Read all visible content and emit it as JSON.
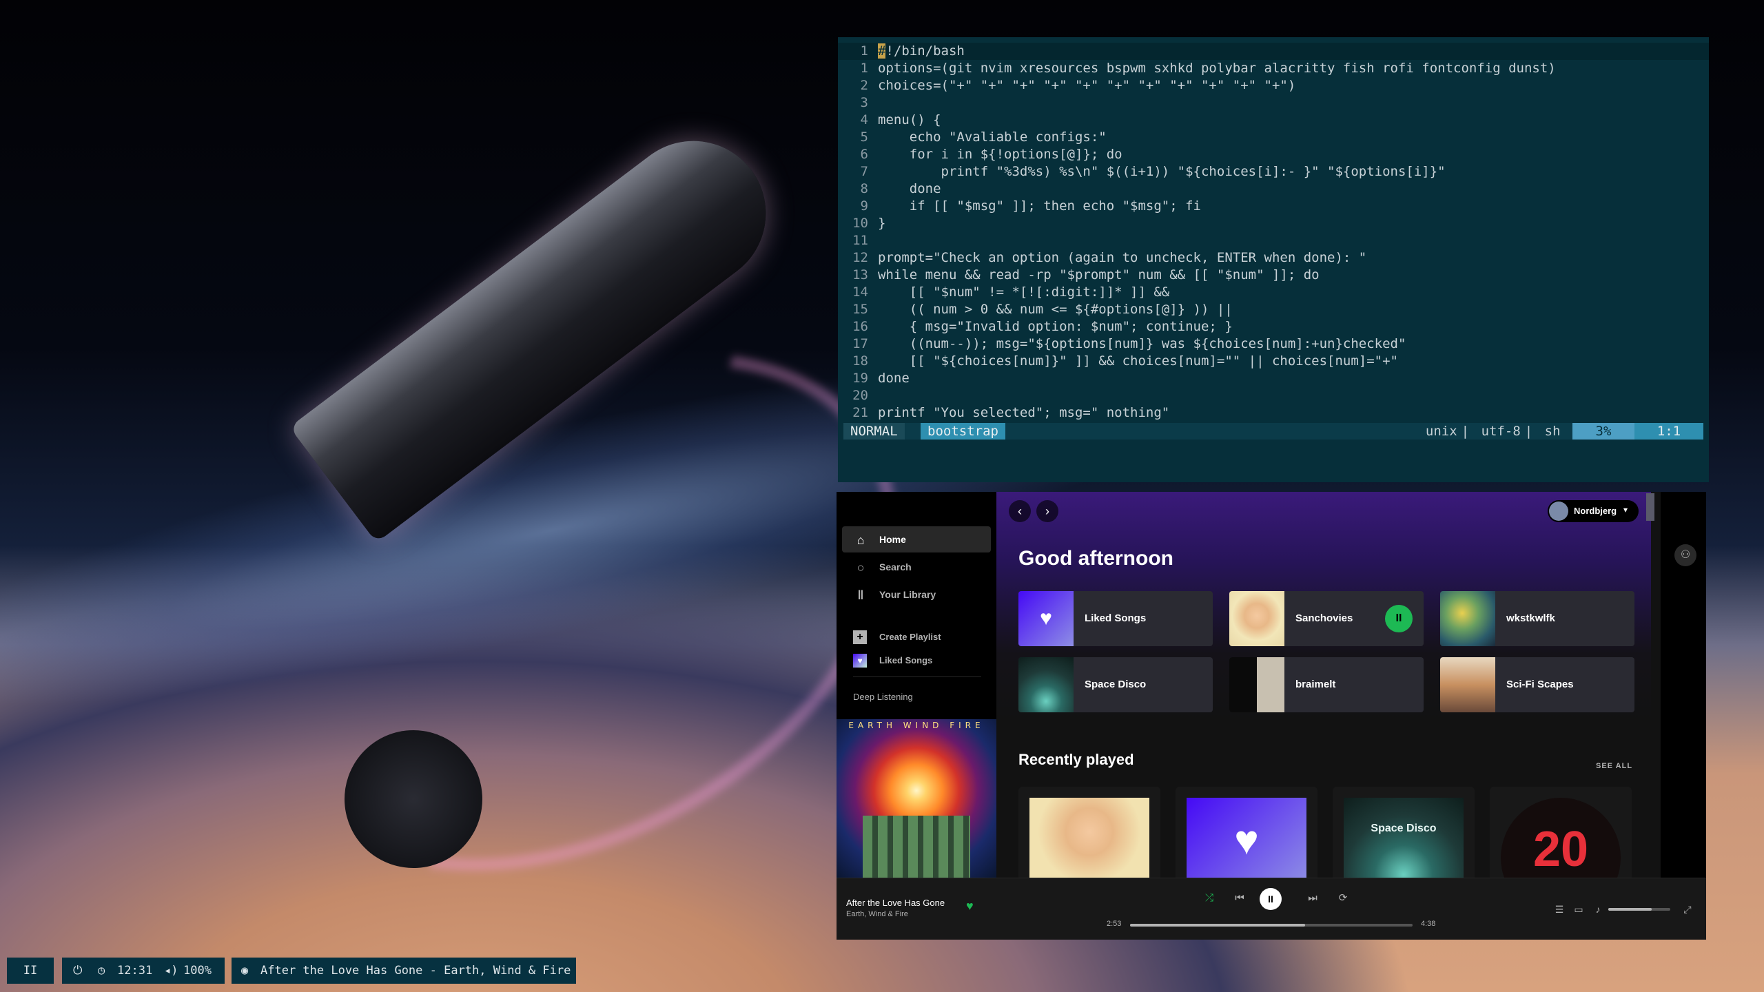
{
  "editor": {
    "lines": [
      {
        "num": "1",
        "text": "#!/bin/bash",
        "cursor": true
      },
      {
        "num": "1",
        "text": "options=(git nvim xresources bspwm sxhkd polybar alacritty fish rofi fontconfig dunst)"
      },
      {
        "num": "2",
        "text": "choices=(\"+\" \"+\" \"+\" \"+\" \"+\" \"+\" \"+\" \"+\" \"+\" \"+\" \"+\")"
      },
      {
        "num": "3",
        "text": ""
      },
      {
        "num": "4",
        "text": "menu() {"
      },
      {
        "num": "5",
        "text": "    echo \"Avaliable configs:\""
      },
      {
        "num": "6",
        "text": "    for i in ${!options[@]}; do"
      },
      {
        "num": "7",
        "text": "        printf \"%3d%s) %s\\n\" $((i+1)) \"${choices[i]:- }\" \"${options[i]}\""
      },
      {
        "num": "8",
        "text": "    done"
      },
      {
        "num": "9",
        "text": "    if [[ \"$msg\" ]]; then echo \"$msg\"; fi"
      },
      {
        "num": "10",
        "text": "}"
      },
      {
        "num": "11",
        "text": ""
      },
      {
        "num": "12",
        "text": "prompt=\"Check an option (again to uncheck, ENTER when done): \""
      },
      {
        "num": "13",
        "text": "while menu && read -rp \"$prompt\" num && [[ \"$num\" ]]; do"
      },
      {
        "num": "14",
        "text": "    [[ \"$num\" != *[![:digit:]]* ]] &&"
      },
      {
        "num": "15",
        "text": "    (( num > 0 && num <= ${#options[@]} )) ||"
      },
      {
        "num": "16",
        "text": "    { msg=\"Invalid option: $num\"; continue; }"
      },
      {
        "num": "17",
        "text": "    ((num--)); msg=\"${options[num]} was ${choices[num]:+un}checked\""
      },
      {
        "num": "18",
        "text": "    [[ \"${choices[num]}\" ]] && choices[num]=\"\" || choices[num]=\"+\""
      },
      {
        "num": "19",
        "text": "done"
      },
      {
        "num": "20",
        "text": ""
      },
      {
        "num": "21",
        "text": "printf \"You selected\"; msg=\" nothing\""
      }
    ],
    "status": {
      "mode": "NORMAL",
      "branch": "bootstrap",
      "format": "unix",
      "encoding": "utf-8",
      "filetype": "sh",
      "percent": "3%",
      "position": "1:1"
    }
  },
  "spotify": {
    "nav": [
      {
        "icon": "home-icon",
        "glyph": "⌂",
        "label": "Home",
        "active": true
      },
      {
        "icon": "search-icon",
        "glyph": "○",
        "label": "Search",
        "active": false
      },
      {
        "icon": "library-icon",
        "glyph": "‖",
        "label": "Your Library",
        "active": false
      }
    ],
    "create_playlist": "Create Playlist",
    "liked_songs": "Liked Songs",
    "playlist_item": "Deep Listening",
    "album_art_title": "EARTH WIND FIRE",
    "user": "Nordbjerg",
    "greeting": "Good afternoon",
    "tiles": [
      {
        "name": "Liked Songs",
        "color": "#5b3ee0"
      },
      {
        "name": "Sanchovies",
        "color": "#e8d8a8",
        "playing": true
      },
      {
        "name": "wkstkwlfk",
        "color": "#3a6a4a"
      },
      {
        "name": "Space Disco",
        "color": "#1e3a38"
      },
      {
        "name": "braimelt",
        "color": "#d8d8d8"
      },
      {
        "name": "Sci-Fi Scapes",
        "color": "#c89060"
      }
    ],
    "pause_glyph": "II",
    "recently_played": "Recently played",
    "see_all": "SEE ALL",
    "cards": [
      {
        "color": "#f2e2b0",
        "label": ""
      },
      {
        "color": "#6a48f0",
        "label": ""
      },
      {
        "color": "#1e3a38",
        "label": "Space Disco"
      },
      {
        "color": "#140c0c",
        "label": "20"
      }
    ],
    "player": {
      "title": "After the Love Has Gone",
      "artist": "Earth, Wind & Fire",
      "elapsed": "2:53",
      "duration": "4:38",
      "progress": 0.62,
      "volume": 0.7
    }
  },
  "polybar": {
    "workspace": "II",
    "time": "12:31",
    "volume": "100%",
    "song": "After the Love Has Gone - Earth, Wind & Fire"
  },
  "colors": {
    "accent": "#1db954",
    "editor_bg": "#062f3a"
  }
}
